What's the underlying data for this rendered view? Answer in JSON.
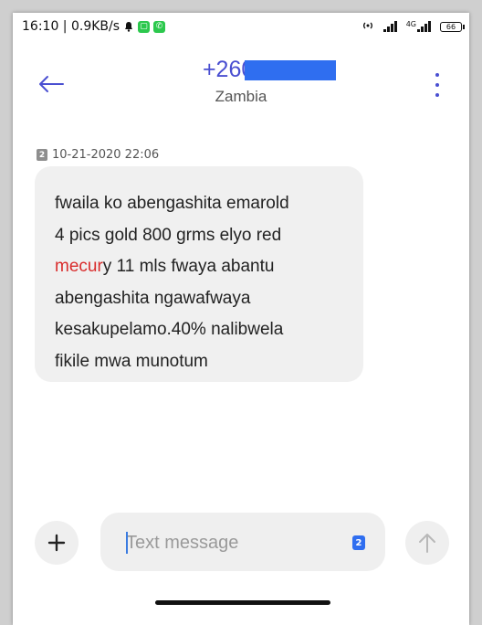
{
  "status_bar": {
    "time_speed": "16:10 | 0.9KB/s",
    "signal_label": "4G",
    "battery": "66"
  },
  "header": {
    "title": "+26096",
    "subtitle": "Zambia"
  },
  "message": {
    "sim": "2",
    "timestamp": "10-21-2020 22:06",
    "lines": [
      "fwaila ko abengashita emarold",
      "4 pics gold 800 grms elyo red",
      "y 11 mls fwaya abantu",
      "abengashita ngawafwaya",
      "kesakupelamo.40% nalibwela",
      "fikile mwa munotum"
    ],
    "highlight_word": "mecur"
  },
  "composer": {
    "placeholder": "Text message",
    "sim_badge": "2"
  },
  "colors": {
    "accent": "#4a4fd1",
    "highlight": "#d92c2c",
    "bubble": "#f0f0f0"
  }
}
